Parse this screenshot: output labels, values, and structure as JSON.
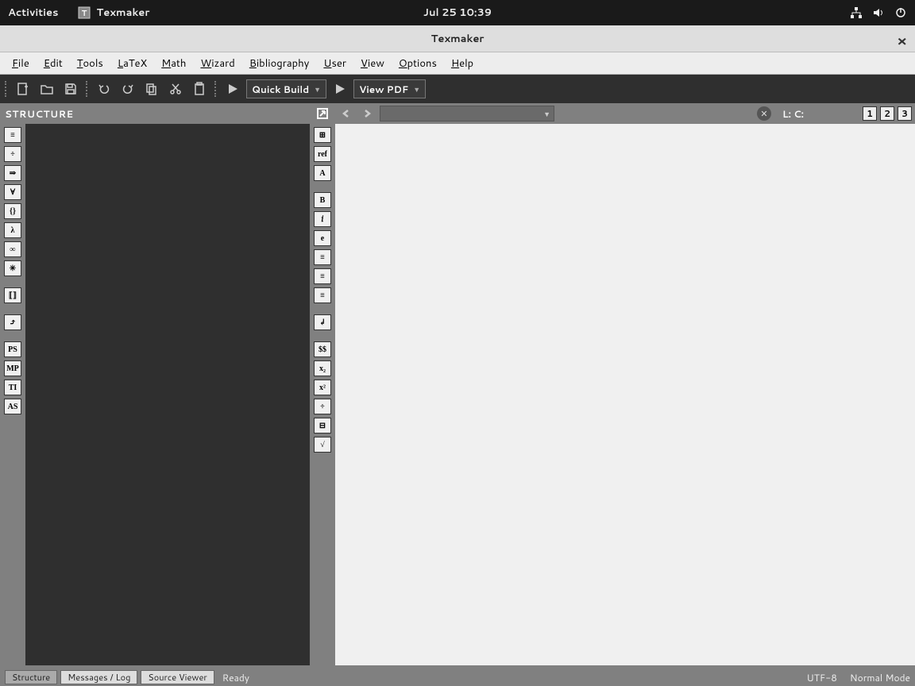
{
  "gnome": {
    "activities": "Activities",
    "app_name": "Texmaker",
    "datetime": "Jul 25  10:39"
  },
  "titlebar": {
    "title": "Texmaker"
  },
  "menubar": {
    "items": [
      {
        "u": "F",
        "rest": "ile"
      },
      {
        "u": "E",
        "rest": "dit"
      },
      {
        "u": "T",
        "rest": "ools"
      },
      {
        "u": "L",
        "rest": "aTeX"
      },
      {
        "u": "M",
        "rest": "ath"
      },
      {
        "u": "W",
        "rest": "izard"
      },
      {
        "u": "B",
        "rest": "ibliography"
      },
      {
        "u": "U",
        "rest": "ser"
      },
      {
        "u": "V",
        "rest": "iew"
      },
      {
        "u": "O",
        "rest": "ptions"
      },
      {
        "u": "H",
        "rest": "elp"
      }
    ]
  },
  "toolbar": {
    "quick_build": "Quick Build",
    "view_pdf": "View PDF"
  },
  "structure": {
    "title": "STRUCTURE"
  },
  "left_symbols": [
    "≡",
    "÷",
    "⇒",
    "∀",
    "{}",
    "λ",
    "∞",
    "✳",
    "⟦⟧",
    "⤴",
    "PS",
    "MP",
    "TI",
    "AS"
  ],
  "center_symbols": [
    "⊞",
    "ref",
    "A",
    "B",
    "𝑖",
    "e",
    "≡",
    "≡",
    "≡",
    "↲",
    "$$",
    "x₂",
    "x²",
    "÷",
    "⊟",
    "√"
  ],
  "editor_hdr": {
    "lc": "L:  C:"
  },
  "pane_nums": [
    "1",
    "2",
    "3"
  ],
  "status": {
    "structure": "Structure",
    "messages": "Messages / Log",
    "source": "Source Viewer",
    "ready": "Ready",
    "encoding": "UTF-8",
    "mode": "Normal Mode"
  }
}
